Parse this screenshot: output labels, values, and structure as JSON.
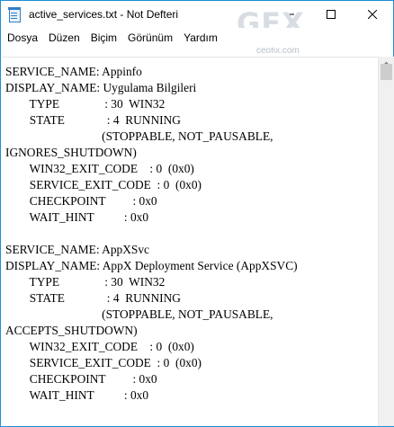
{
  "window": {
    "title": "active_services.txt - Not Defteri"
  },
  "watermark": {
    "logo": "GFX",
    "url": "ceofix.com"
  },
  "menu": [
    {
      "label": "Dosya"
    },
    {
      "label": "Düzen"
    },
    {
      "label": "Biçim"
    },
    {
      "label": "Görünüm"
    },
    {
      "label": "Yardım"
    }
  ],
  "editor": {
    "content": "SERVICE_NAME: Appinfo\nDISPLAY_NAME: Uygulama Bilgileri\n        TYPE               : 30  WIN32\n        STATE              : 4  RUNNING\n                                (STOPPABLE, NOT_PAUSABLE,\nIGNORES_SHUTDOWN)\n        WIN32_EXIT_CODE    : 0  (0x0)\n        SERVICE_EXIT_CODE  : 0  (0x0)\n        CHECKPOINT         : 0x0\n        WAIT_HINT          : 0x0\n\nSERVICE_NAME: AppXSvc\nDISPLAY_NAME: AppX Deployment Service (AppXSVC)\n        TYPE               : 30  WIN32\n        STATE              : 4  RUNNING\n                                (STOPPABLE, NOT_PAUSABLE,\nACCEPTS_SHUTDOWN)\n        WIN32_EXIT_CODE    : 0  (0x0)\n        SERVICE_EXIT_CODE  : 0  (0x0)\n        CHECKPOINT         : 0x0\n        WAIT_HINT          : 0x0"
  },
  "colors": {
    "accent": "#1e90d6",
    "text": "#000000",
    "scrollbar": "#f0f0f0",
    "thumb": "#cdcdcd"
  }
}
